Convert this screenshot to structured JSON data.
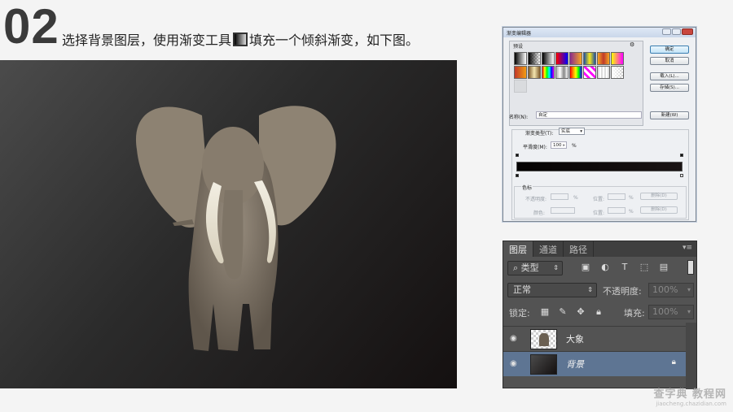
{
  "step_number": "02",
  "headline": {
    "before_icon": "选择背景图层，使用渐变工具",
    "after_icon": "填充一个倾斜渐变，如下图。",
    "icon": "gradient-tool-icon"
  },
  "canvas": {
    "subject": "elephant-photo",
    "gradient_start": "#4b4b4b",
    "gradient_end": "#141010"
  },
  "gradient_editor": {
    "title": "渐变编辑器",
    "presets_label": "预设",
    "buttons": {
      "ok": "确定",
      "cancel": "取消",
      "load": "载入(L)...",
      "save": "存储(S)...",
      "new": "新建(W)"
    },
    "name_label": "名称(N):",
    "name_value": "自定",
    "gradient_type_label": "渐变类型(T):",
    "gradient_type_value": "实底",
    "smoothness_label": "平滑度(M):",
    "smoothness_value": "100",
    "smoothness_unit": "%",
    "stops_label": "色标",
    "opacity_label": "不透明度:",
    "opacity_unit": "%",
    "color_label": "颜色:",
    "location_label": "位置:",
    "location_unit": "%",
    "delete_label": "删除(D)",
    "bar_start_color": "#050303",
    "bar_end_color": "#1a1414"
  },
  "layers_panel": {
    "tabs": [
      "图层",
      "通道",
      "路径"
    ],
    "active_tab": "图层",
    "filter_kind": "类型",
    "blend_mode": "正常",
    "opacity_label": "不透明度:",
    "opacity_value": "100%",
    "lock_label": "锁定:",
    "fill_label": "填充:",
    "fill_value": "100%",
    "layers": [
      {
        "name": "大象",
        "selected": false,
        "locked": false
      },
      {
        "name": "背景",
        "selected": true,
        "locked": true
      }
    ],
    "selection_color": "#5e7593"
  },
  "watermark": {
    "main": "查字典 教程网",
    "sub": "jiaocheng.chazidian.com"
  }
}
